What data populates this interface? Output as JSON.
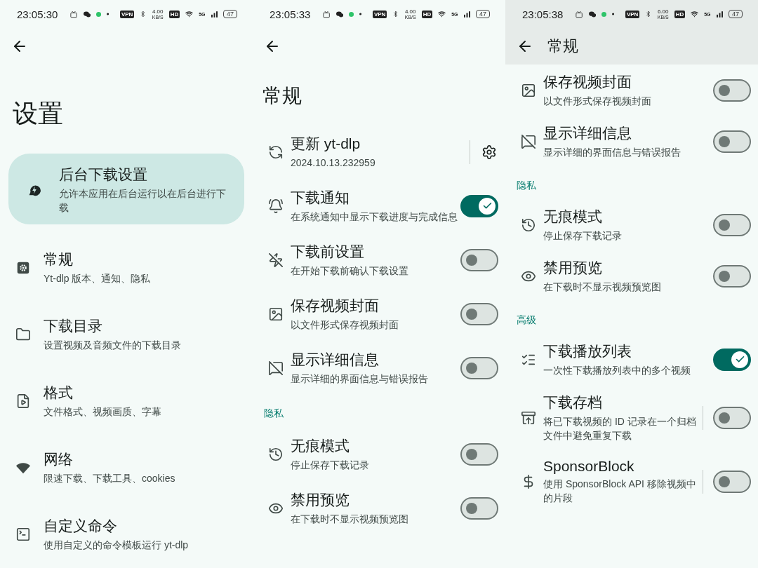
{
  "screens": [
    {
      "status": {
        "time": "23:05:30",
        "vpn": "VPN",
        "speed": "4.00",
        "speed_unit": "KB/S",
        "hd": "HD",
        "network": "5G",
        "battery": "47"
      },
      "header": {
        "kind": "large",
        "title": "设置"
      },
      "rows": [
        {
          "kind": "card",
          "title": "后台下载设置",
          "subtitle": "允许本应用在后台运行以在后台进行下载"
        },
        {
          "kind": "nav",
          "title": "常规",
          "subtitle": "Yt-dlp 版本、通知、隐私"
        },
        {
          "kind": "nav",
          "title": "下载目录",
          "subtitle": "设置视频及音频文件的下载目录"
        },
        {
          "kind": "nav",
          "title": "格式",
          "subtitle": "文件格式、视频画质、字幕"
        },
        {
          "kind": "nav",
          "title": "网络",
          "subtitle": "限速下载、下载工具、cookies"
        },
        {
          "kind": "nav",
          "title": "自定义命令",
          "subtitle": "使用自定义的命令模板运行 yt-dlp"
        }
      ]
    },
    {
      "status": {
        "time": "23:05:33",
        "vpn": "VPN",
        "speed": "4.00",
        "speed_unit": "KB/S",
        "hd": "HD",
        "network": "5G",
        "battery": "47"
      },
      "header": {
        "kind": "large",
        "title": "常规"
      },
      "rows": [
        {
          "kind": "update",
          "title": "更新 yt-dlp",
          "subtitle": "2024.10.13.232959"
        },
        {
          "kind": "switch",
          "title": "下载通知",
          "subtitle": "在系统通知中显示下载进度与完成信息",
          "on": true,
          "split": false
        },
        {
          "kind": "switch",
          "title": "下载前设置",
          "subtitle": "在开始下载前确认下载设置",
          "on": false,
          "split": false
        },
        {
          "kind": "switch",
          "title": "保存视频封面",
          "subtitle": "以文件形式保存视频封面",
          "on": false,
          "split": false
        },
        {
          "kind": "switch",
          "title": "显示详细信息",
          "subtitle": "显示详细的界面信息与错误报告",
          "on": false,
          "split": false
        },
        {
          "kind": "section",
          "title": "隐私"
        },
        {
          "kind": "switch",
          "title": "无痕模式",
          "subtitle": "停止保存下载记录",
          "on": false,
          "split": false
        },
        {
          "kind": "switch",
          "title": "禁用预览",
          "subtitle": "在下载时不显示视频预览图",
          "on": false,
          "split": false
        }
      ]
    },
    {
      "status": {
        "time": "23:05:38",
        "vpn": "VPN",
        "speed": "6.00",
        "speed_unit": "KB/S",
        "hd": "HD",
        "network": "5G",
        "battery": "47"
      },
      "header": {
        "kind": "bar",
        "title": "常规"
      },
      "rows": [
        {
          "kind": "switch",
          "title": "保存视频封面",
          "subtitle": "以文件形式保存视频封面",
          "on": false,
          "split": false
        },
        {
          "kind": "switch",
          "title": "显示详细信息",
          "subtitle": "显示详细的界面信息与错误报告",
          "on": false,
          "split": false
        },
        {
          "kind": "section",
          "title": "隐私"
        },
        {
          "kind": "switch",
          "title": "无痕模式",
          "subtitle": "停止保存下载记录",
          "on": false,
          "split": false
        },
        {
          "kind": "switch",
          "title": "禁用预览",
          "subtitle": "在下载时不显示视频预览图",
          "on": false,
          "split": false
        },
        {
          "kind": "section",
          "title": "高级"
        },
        {
          "kind": "switch",
          "title": "下载播放列表",
          "subtitle": "一次性下载播放列表中的多个视频",
          "on": true,
          "split": false
        },
        {
          "kind": "switch",
          "title": "下载存档",
          "subtitle": "将已下载视频的 ID 记录在一个归档文件中避免重复下载",
          "on": false,
          "split": true
        },
        {
          "kind": "switch",
          "title": "SponsorBlock",
          "subtitle": "使用 SponsorBlock API 移除视频中的片段",
          "on": false,
          "split": true
        }
      ]
    }
  ]
}
